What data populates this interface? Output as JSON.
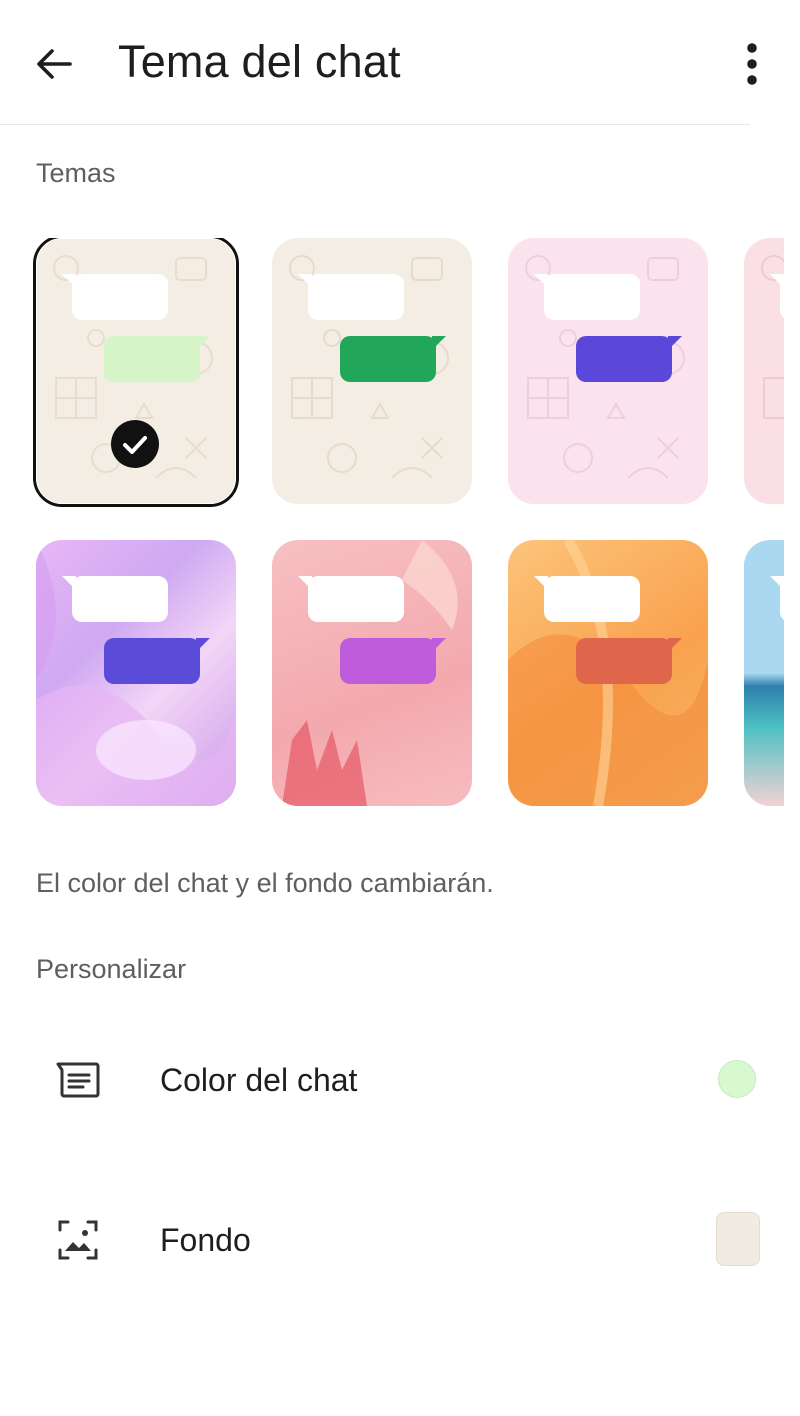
{
  "header": {
    "title": "Tema del chat",
    "back_icon": "arrow-left-icon",
    "more_icon": "more-vertical-icon"
  },
  "themes_section": {
    "label": "Temas",
    "selected_index": 0,
    "tiles": [
      {
        "background": "#f3ede4",
        "pattern": "doodle",
        "pattern_color": "#e7dccd",
        "bubble_out_color": "#d6f5c9"
      },
      {
        "background": "#f3ede4",
        "pattern": "doodle",
        "pattern_color": "#e5dacb",
        "bubble_out_color": "#22a75a"
      },
      {
        "background": "#fbe3ee",
        "pattern": "doodle",
        "pattern_color": "#efcde0",
        "bubble_out_color": "#5b48da"
      },
      {
        "background": "#fae0e4",
        "pattern": "doodle",
        "pattern_color": "#eccbd3",
        "bubble_out_color": "#e2a3ad"
      },
      {
        "background": "#d8c3f3",
        "pattern": "gradient",
        "pattern_color": "#c591ee",
        "bubble_out_color": "#5a4bd8"
      },
      {
        "background": "#f6b4ba",
        "pattern": "gradient",
        "pattern_color": "#e7636f",
        "bubble_out_color": "#be5cdd"
      },
      {
        "background": "#fbb466",
        "pattern": "gradient",
        "pattern_color": "#f28a3a",
        "bubble_out_color": "#e0664b"
      },
      {
        "background": "#a9d8f0",
        "pattern": "beach",
        "pattern_color": "#4aa6b8",
        "bubble_out_color": "#ffffff"
      }
    ]
  },
  "description": "El color del chat y el fondo cambiarán.",
  "customize_section": {
    "label": "Personalizar",
    "items": [
      {
        "label": "Color del chat",
        "icon": "chat-color-icon",
        "swatch_color": "#d8f8d0"
      },
      {
        "label": "Fondo",
        "icon": "wallpaper-icon",
        "swatch_color": "#f1ece2"
      }
    ]
  },
  "colors": {
    "selection_outline": "#111111",
    "secondary_text": "#5f5f5f"
  }
}
